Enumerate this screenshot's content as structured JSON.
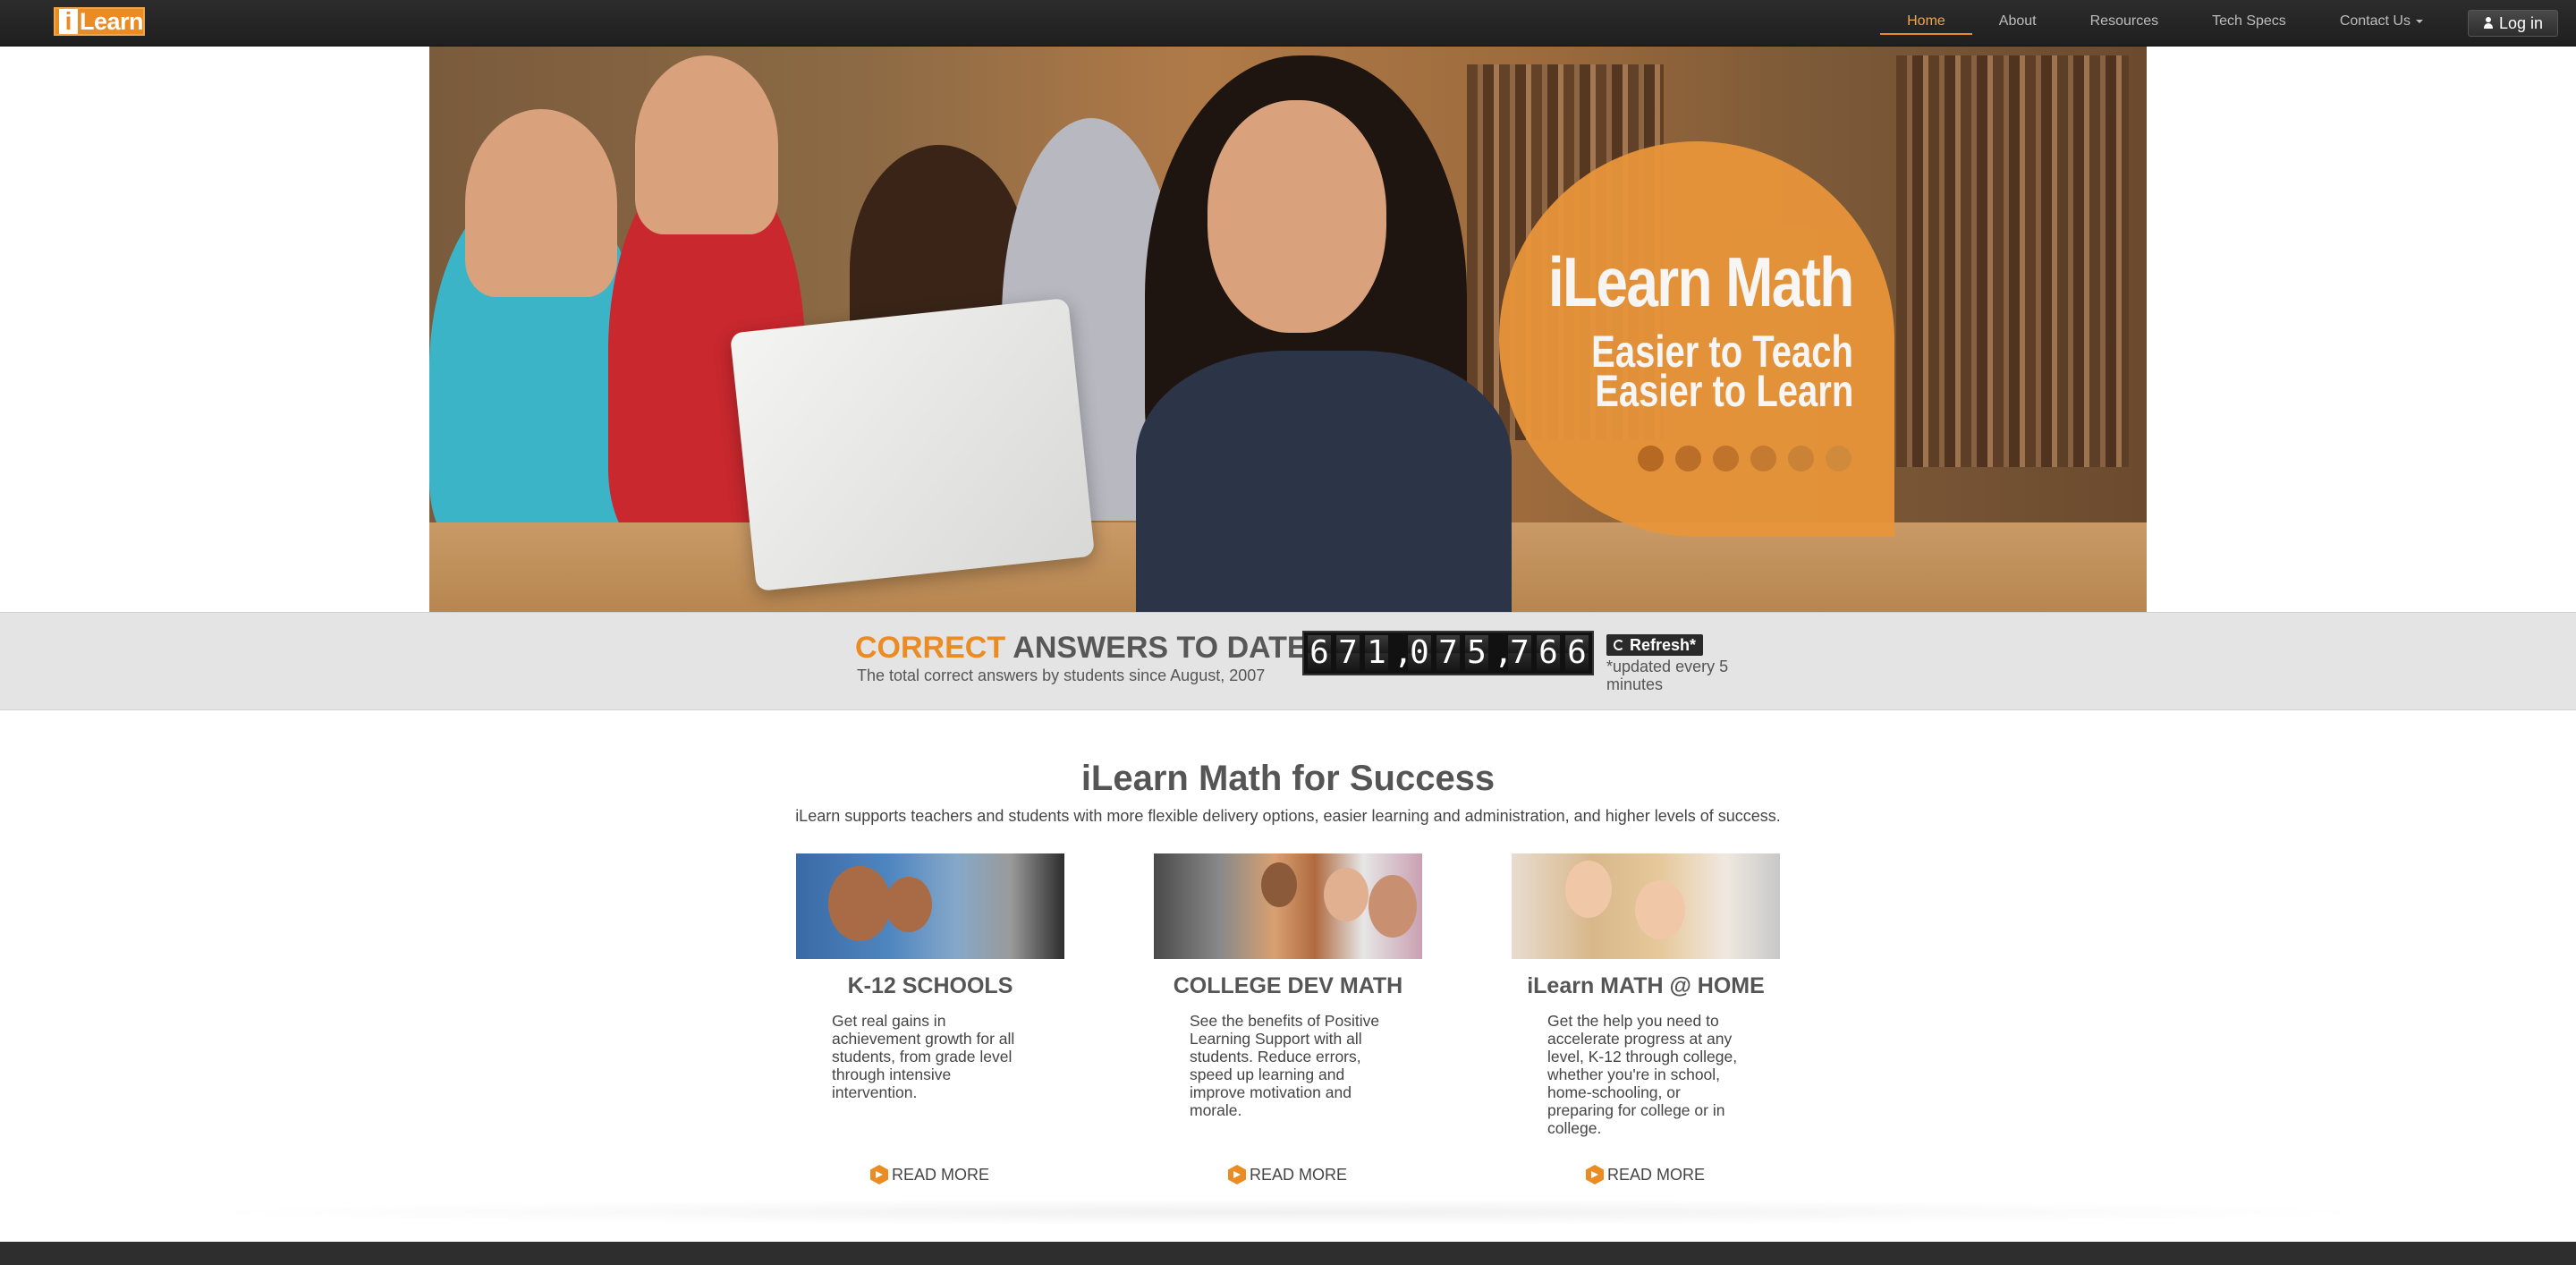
{
  "header": {
    "logo": {
      "i": "i",
      "rest": "Learn"
    },
    "nav": [
      {
        "label": "Home",
        "active": true
      },
      {
        "label": "About"
      },
      {
        "label": "Resources"
      },
      {
        "label": "Tech Specs"
      },
      {
        "label": "Contact Us",
        "dropdown": true
      }
    ],
    "login_label": "Log in"
  },
  "hero": {
    "title": "iLearn Math",
    "line1": "Easier to Teach",
    "line2": "Easier to Learn",
    "slide_count": 6
  },
  "counter": {
    "title_highlight": "CORRECT",
    "title_rest": " ANSWERS TO DATE",
    "subtitle": "The total correct answers by students since August, 2007",
    "digits": [
      "6",
      "7",
      "1",
      ",",
      "0",
      "7",
      "5",
      ",",
      "7",
      "6",
      "6"
    ],
    "refresh_label": "Refresh*",
    "note": "*updated every 5 minutes"
  },
  "main": {
    "title": "iLearn Math for Success",
    "subtitle": "iLearn supports teachers and students with more flexible delivery options, easier learning and administration, and higher levels of success.",
    "cards": [
      {
        "title": "K-12 SCHOOLS",
        "text": "Get real gains in achievement growth for all students, from grade level through intensive intervention.",
        "link": "READ MORE"
      },
      {
        "title": "COLLEGE DEV MATH",
        "text": "See the benefits of Positive Learning Support with all students. Reduce errors, speed up learning and improve motivation and morale.",
        "link": "READ MORE"
      },
      {
        "title": "iLearn MATH @ HOME",
        "text": "Get the help you need to accelerate progress at any level, K-12 through college, whether you're in school, home-schooling, or preparing for college or in college.",
        "link": "READ MORE"
      }
    ]
  },
  "colors": {
    "accent": "#ea8b24",
    "navbar": "#262626",
    "band": "#e4e4e4"
  }
}
